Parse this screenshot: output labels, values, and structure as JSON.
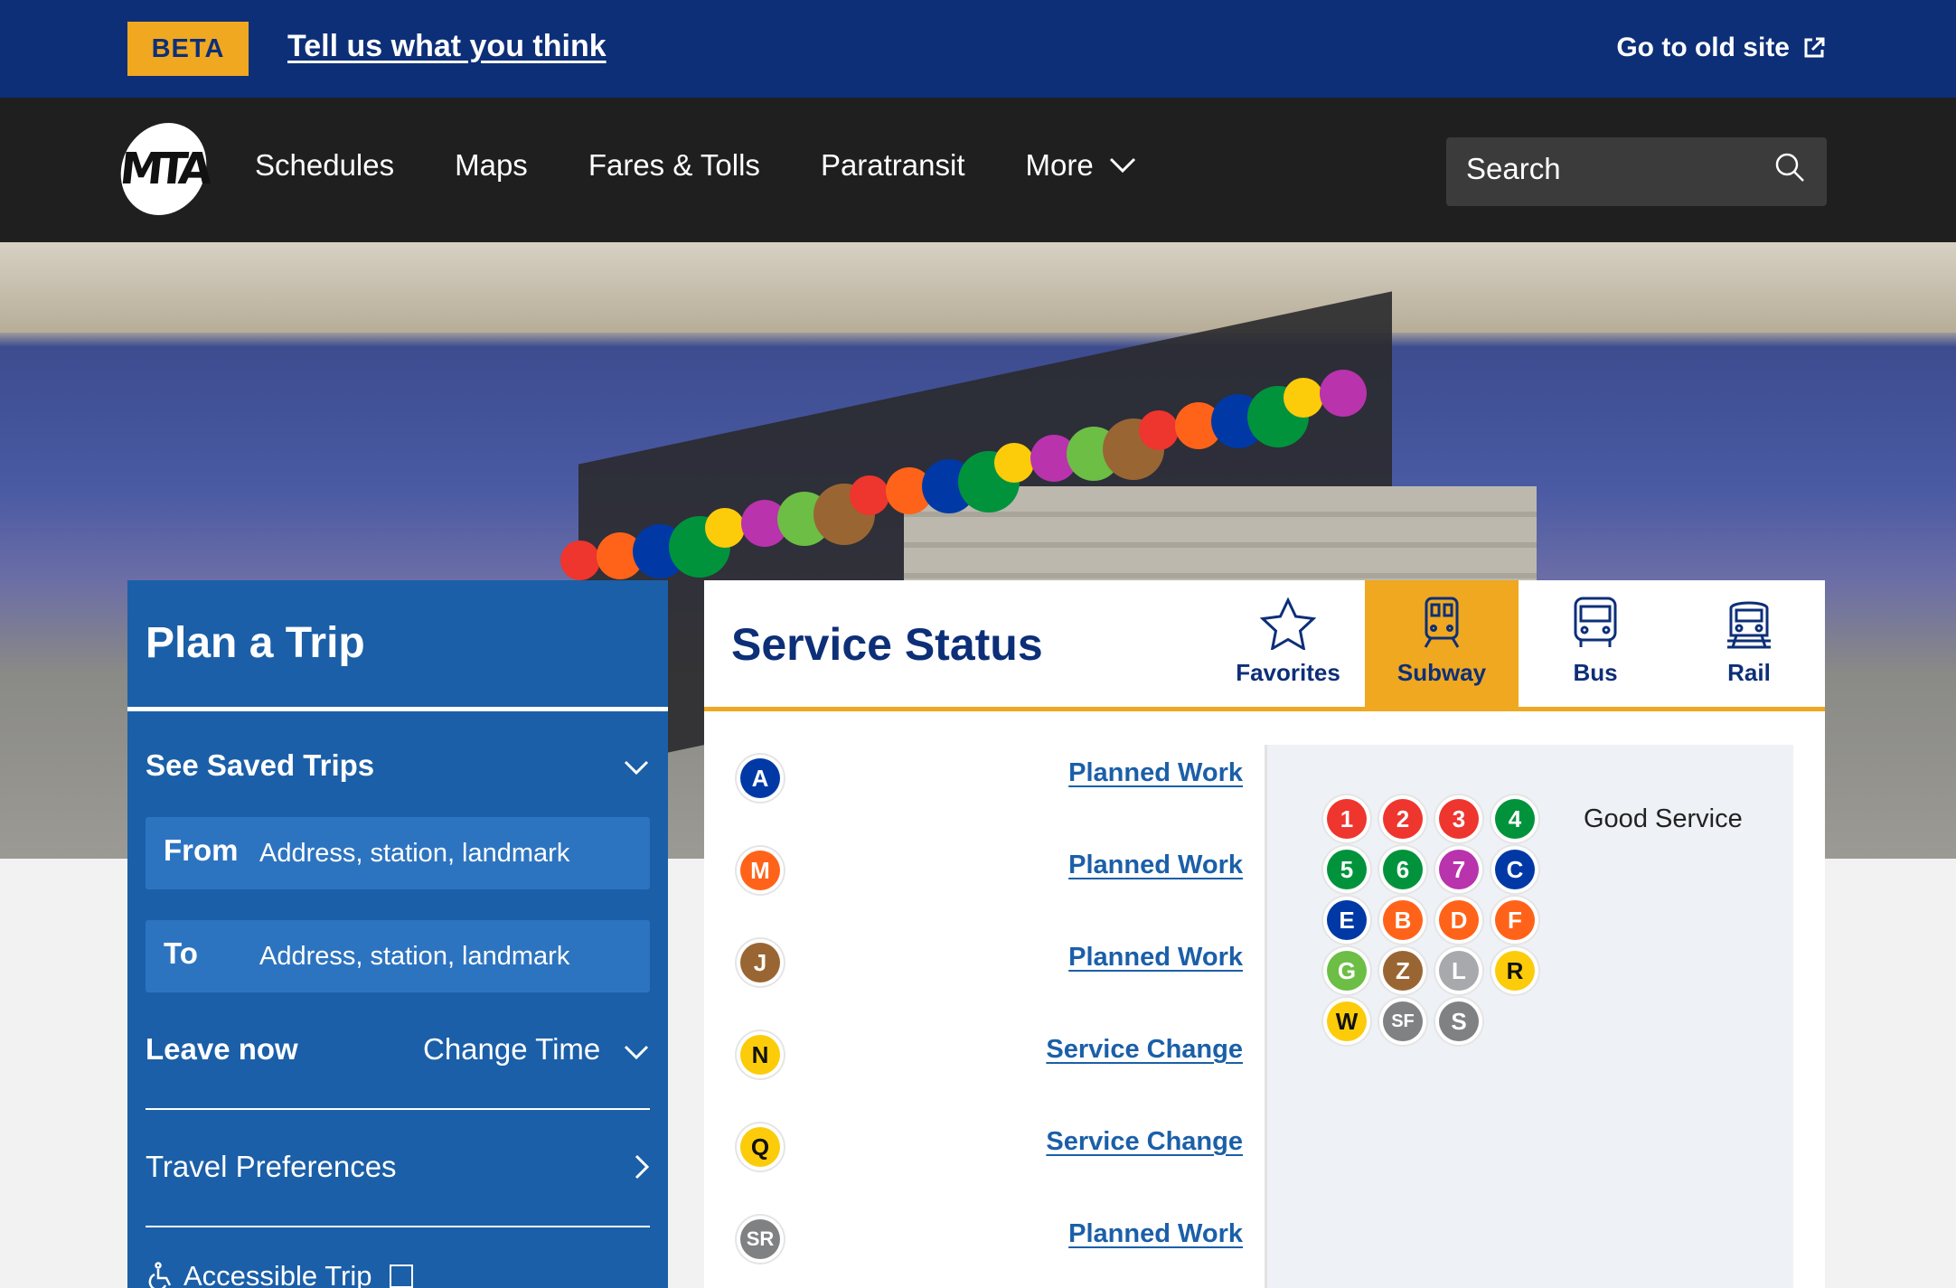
{
  "beta": {
    "badge": "BETA",
    "feedback": "Tell us what you think",
    "old_site": "Go to old site"
  },
  "nav": {
    "logo": "MTA",
    "items": [
      "Schedules",
      "Maps",
      "Fares & Tolls",
      "Paratransit",
      "More"
    ],
    "search_placeholder": "Search"
  },
  "plan": {
    "title": "Plan a Trip",
    "saved": "See Saved Trips",
    "from_label": "From",
    "from_placeholder": "Address, station, landmark",
    "to_label": "To",
    "to_placeholder": "Address, station, landmark",
    "leave": "Leave now",
    "change_time": "Change Time",
    "preferences": "Travel Preferences",
    "accessible": "Accessible Trip"
  },
  "status": {
    "title": "Service Status",
    "tabs": [
      {
        "label": "Favorites",
        "icon": "star-icon"
      },
      {
        "label": "Subway",
        "icon": "subway-icon"
      },
      {
        "label": "Bus",
        "icon": "bus-icon"
      },
      {
        "label": "Rail",
        "icon": "rail-icon"
      }
    ],
    "active_tab": "Subway",
    "lines": [
      {
        "line": "A",
        "color": "#0039a6",
        "status": "Planned Work"
      },
      {
        "line": "M",
        "color": "#ff6319",
        "status": "Planned Work"
      },
      {
        "line": "J",
        "color": "#996633",
        "status": "Planned Work"
      },
      {
        "line": "N",
        "color": "#fccc0a",
        "status": "Service Change"
      },
      {
        "line": "Q",
        "color": "#fccc0a",
        "status": "Service Change"
      },
      {
        "line": "SR",
        "color": "#808183",
        "status": "Planned Work"
      }
    ],
    "good_service_label": "Good Service",
    "good_service_lines": [
      {
        "line": "1",
        "color": "#ee352e"
      },
      {
        "line": "2",
        "color": "#ee352e"
      },
      {
        "line": "3",
        "color": "#ee352e"
      },
      {
        "line": "4",
        "color": "#00933c"
      },
      {
        "line": "5",
        "color": "#00933c"
      },
      {
        "line": "6",
        "color": "#00933c"
      },
      {
        "line": "7",
        "color": "#b933ad"
      },
      {
        "line": "C",
        "color": "#0039a6"
      },
      {
        "line": "E",
        "color": "#0039a6"
      },
      {
        "line": "B",
        "color": "#ff6319"
      },
      {
        "line": "D",
        "color": "#ff6319"
      },
      {
        "line": "F",
        "color": "#ff6319"
      },
      {
        "line": "G",
        "color": "#6cbe45"
      },
      {
        "line": "Z",
        "color": "#996633"
      },
      {
        "line": "L",
        "color": "#a7a9ac"
      },
      {
        "line": "R",
        "color": "#fccc0a"
      },
      {
        "line": "W",
        "color": "#fccc0a"
      },
      {
        "line": "SF",
        "color": "#808183"
      },
      {
        "line": "S",
        "color": "#808183"
      }
    ]
  },
  "colors": {
    "navy": "#0d2f78",
    "gold": "#f0a820",
    "plan_blue": "#1b5fa8",
    "nav_dark": "#1f1f1f"
  }
}
